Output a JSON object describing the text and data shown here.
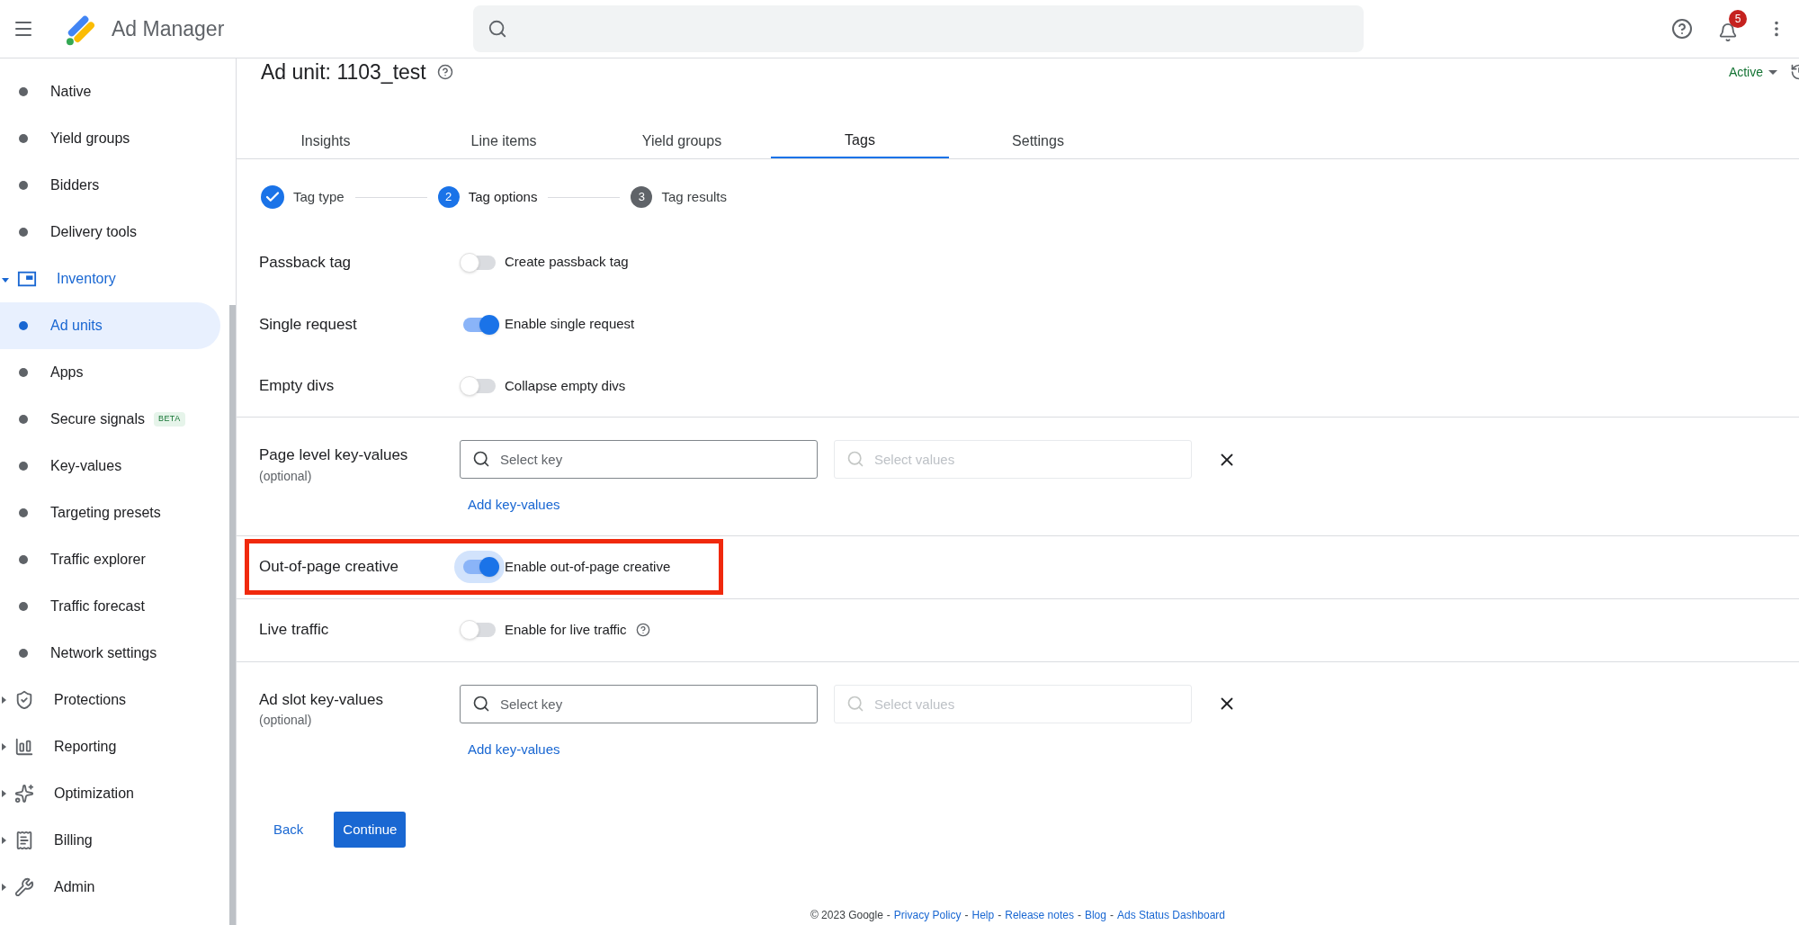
{
  "app": {
    "title": "Ad Manager",
    "notification_count": "5"
  },
  "sidebar": {
    "items": [
      {
        "kind": "dot",
        "label": "Native",
        "selected": false
      },
      {
        "kind": "dot",
        "label": "Yield groups",
        "selected": false
      },
      {
        "kind": "dot",
        "label": "Bidders",
        "selected": false
      },
      {
        "kind": "dot",
        "label": "Delivery tools",
        "selected": false
      },
      {
        "kind": "section",
        "label": "Inventory",
        "selected": false,
        "expanded": true
      },
      {
        "kind": "dot",
        "label": "Ad units",
        "selected": true
      },
      {
        "kind": "dot",
        "label": "Apps",
        "selected": false
      },
      {
        "kind": "dot",
        "label": "Secure signals",
        "selected": false,
        "badge": "BETA"
      },
      {
        "kind": "dot",
        "label": "Key-values",
        "selected": false
      },
      {
        "kind": "dot",
        "label": "Targeting presets",
        "selected": false
      },
      {
        "kind": "dot",
        "label": "Traffic explorer",
        "selected": false
      },
      {
        "kind": "dot",
        "label": "Traffic forecast",
        "selected": false
      },
      {
        "kind": "dot",
        "label": "Network settings",
        "selected": false
      },
      {
        "kind": "section",
        "label": "Protections",
        "selected": false,
        "expanded": false
      },
      {
        "kind": "section",
        "label": "Reporting",
        "selected": false,
        "expanded": false
      },
      {
        "kind": "section",
        "label": "Optimization",
        "selected": false,
        "expanded": false
      },
      {
        "kind": "section",
        "label": "Billing",
        "selected": false,
        "expanded": false
      },
      {
        "kind": "section",
        "label": "Admin",
        "selected": false,
        "expanded": false
      }
    ]
  },
  "page": {
    "title": "Ad unit: 1103_test",
    "status": "Active"
  },
  "tabs": [
    {
      "label": "Insights",
      "selected": false
    },
    {
      "label": "Line items",
      "selected": false
    },
    {
      "label": "Yield groups",
      "selected": false
    },
    {
      "label": "Tags",
      "selected": true
    },
    {
      "label": "Settings",
      "selected": false
    }
  ],
  "steps": [
    {
      "label": "Tag type",
      "done": true,
      "current": false
    },
    {
      "label": "Tag options",
      "number": "2",
      "done": false,
      "current": true
    },
    {
      "label": "Tag results",
      "number": "3",
      "done": false,
      "current": false
    }
  ],
  "rows": [
    {
      "kind": "toggle",
      "label": "Passback tag",
      "text": "Create passback tag",
      "on": false,
      "focused": false,
      "highlighted": false,
      "help": false,
      "divider": false
    },
    {
      "kind": "toggle",
      "label": "Single request",
      "text": "Enable single request",
      "on": true,
      "focused": false,
      "highlighted": false,
      "help": false,
      "divider": false
    },
    {
      "kind": "toggle",
      "label": "Empty divs",
      "text": "Collapse empty divs",
      "on": false,
      "focused": false,
      "highlighted": false,
      "help": false,
      "divider": true
    },
    {
      "kind": "keyvalues",
      "label": "Page level key-values",
      "sublabel": "(optional)",
      "key_placeholder": "Select key",
      "values_placeholder": "Select values",
      "link": "Add key-values",
      "divider": true
    },
    {
      "kind": "toggle",
      "label": "Out-of-page creative",
      "text": "Enable out-of-page creative",
      "on": true,
      "focused": true,
      "highlighted": true,
      "help": false,
      "divider": true
    },
    {
      "kind": "toggle",
      "label": "Live traffic",
      "text": "Enable for live traffic",
      "on": false,
      "focused": false,
      "highlighted": false,
      "help": true,
      "divider": true
    },
    {
      "kind": "keyvalues",
      "label": "Ad slot key-values",
      "sublabel": "(optional)",
      "key_placeholder": "Select key",
      "values_placeholder": "Select values",
      "link": "Add key-values",
      "divider": false
    }
  ],
  "actions": {
    "back": "Back",
    "continue": "Continue"
  },
  "footer": {
    "parts": [
      {
        "kind": "text",
        "text": "© 2023 Google"
      },
      {
        "kind": "separator",
        "text": "-"
      },
      {
        "kind": "link",
        "text": "Privacy Policy"
      },
      {
        "kind": "separator",
        "text": "-"
      },
      {
        "kind": "link",
        "text": "Help"
      },
      {
        "kind": "separator",
        "text": "-"
      },
      {
        "kind": "link",
        "text": "Release notes"
      },
      {
        "kind": "separator",
        "text": "-"
      },
      {
        "kind": "link",
        "text": "Blog"
      },
      {
        "kind": "separator",
        "text": "-"
      },
      {
        "kind": "link",
        "text": "Ads Status Dashboard"
      }
    ]
  }
}
